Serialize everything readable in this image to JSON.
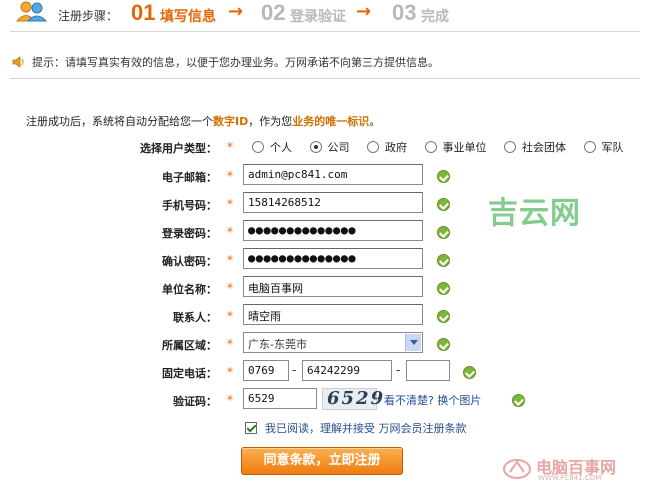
{
  "steps": {
    "label": "注册步骤：",
    "items": [
      {
        "num": "01",
        "text": "填写信息",
        "state": "active"
      },
      {
        "num": "02",
        "text": "登录验证",
        "state": "inactive"
      },
      {
        "num": "03",
        "text": "完成",
        "state": "inactive"
      }
    ],
    "arrow": "→",
    "colors": {
      "active": "#e4660a",
      "inactive": "#b8b8b8"
    }
  },
  "tip": {
    "icon": "speaker-icon",
    "text": "提示：请填写真实有效的信息，以便于您办理业务。万网承诺不向第三方提供信息。"
  },
  "note": {
    "before": "注册成功后，系统将自动分配给您一个",
    "highlight1": "数字ID",
    "middle": "，作为您",
    "highlight2": "业务的唯一标识",
    "after": "。"
  },
  "form": {
    "required_mark": "*",
    "user_type": {
      "label": "选择用户类型：",
      "options": [
        "个人",
        "公司",
        "政府",
        "事业单位",
        "社会团体",
        "军队"
      ],
      "selected": "公司"
    },
    "email": {
      "label": "电子邮箱：",
      "value": "admin@pc841.com"
    },
    "mobile": {
      "label": "手机号码：",
      "value": "15814268512"
    },
    "password": {
      "label": "登录密码：",
      "value": "●●●●●●●●●●●●●●"
    },
    "confirm_password": {
      "label": "确认密码：",
      "value": "●●●●●●●●●●●●●●"
    },
    "company": {
      "label": "单位名称：",
      "value": "电脑百事网"
    },
    "contact": {
      "label": "联系人：",
      "value": "晴空雨"
    },
    "region": {
      "label": "所属区域：",
      "value": "广东-东莞市"
    },
    "phone": {
      "label": "固定电话：",
      "area": "0769",
      "number": "64242299",
      "ext": "",
      "separator": "-"
    },
    "captcha": {
      "label": "验证码：",
      "value": "6529",
      "image_text": "6529",
      "refresh_link": "看不清楚? 换个图片"
    },
    "agree": {
      "text": "我已阅读，理解并接受 万网会员注册条款",
      "checked": true
    },
    "submit_label": "同意条款，立即注册"
  },
  "watermarks": {
    "site1": "吉云网",
    "site2": "电脑百事网",
    "site2_url": "WWW.PC841.COM"
  }
}
